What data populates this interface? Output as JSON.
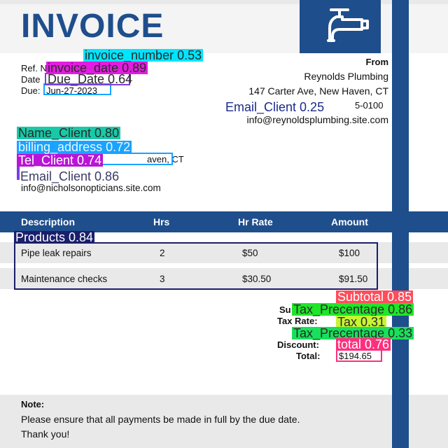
{
  "title": "INVOICE",
  "ref": {
    "ref_prefix": "Ref. N",
    "date_prefix": "Date",
    "due_prefix": "Due:",
    "due_value": "Jun-27-2023"
  },
  "from": {
    "heading": "From",
    "company": "Reynolds Plumbing",
    "address": "147 Carter Ave, New Haven, CT",
    "phone_fragment": "5-0100",
    "email": "info@reynoldsplumbing.site.com"
  },
  "billed": {
    "address_fragment": "aven, CT",
    "email": "info@nicholsonopticians.site.com"
  },
  "table": {
    "headers": [
      "Description",
      "Hrs",
      "Hr Rate",
      "Amount"
    ],
    "rows": [
      {
        "description": "Pipe leak repairs",
        "hrs": "2",
        "rate": "$50",
        "amount": "$100"
      },
      {
        "description": "Maintenance checks",
        "hrs": "3",
        "rate": "$30.50",
        "amount": "$91.50"
      }
    ]
  },
  "totals": {
    "subtotal_fragment": "Su",
    "tax_rate_label": "Tax Rate:",
    "discount_label": "Discount:",
    "total_label": "Total:",
    "total_value": "$194.65"
  },
  "note": {
    "heading": "Note:",
    "line1": "Please ensure that all payments be made in full by the due date.",
    "line2": "Thank you!"
  },
  "detections": [
    {
      "label": "invoice_number 0.53",
      "color": "#00e5ff"
    },
    {
      "label": "invoice_date 0.89",
      "color": "#e21ce0"
    },
    {
      "label": "Due_Date 0.64",
      "color": "#7a3ee6"
    },
    {
      "label": "Email_Client 0.25",
      "color": "#1a2a8a"
    },
    {
      "label": "Name_Client 0.80",
      "color": "#18c9a8"
    },
    {
      "label": "billing_address 0.72",
      "color": "#1aa3ff"
    },
    {
      "label": "Tel_Client 0.74",
      "color": "#b915d6"
    },
    {
      "label": "Email_Client 0.86",
      "color": "#7a3ee6"
    },
    {
      "label": "Products 0.84",
      "color": "#1a1f6b"
    },
    {
      "label": "Subtotal 0.85",
      "color": "#ff4d5a"
    },
    {
      "label": "Tax_Precentage 0.86",
      "color": "#1ee629"
    },
    {
      "label": "Tax 0.31",
      "color": "#c8f531"
    },
    {
      "label": "Tax_Precentage 0.33",
      "color": "#19e05a"
    },
    {
      "label": "total 0.76",
      "color": "#ff2f7d"
    }
  ]
}
